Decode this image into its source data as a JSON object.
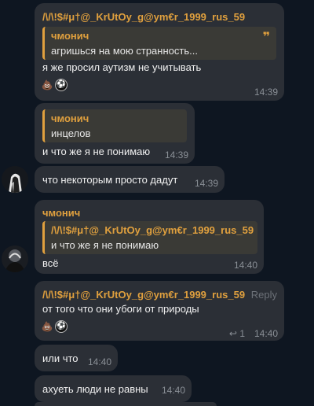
{
  "messages": [
    {
      "sender": "/\\/\\!$#μ†@_KrUtOy_g@ym€r_1999_rus_59",
      "reply": {
        "name": "чмонич",
        "text": "агришься на мою странность..."
      },
      "text": "я же просил аутизм не учитывать",
      "reactions": {
        "poo": "💩",
        "ball": "⚽"
      },
      "time": "14:39"
    },
    {
      "reply": {
        "name": "чмонич",
        "text": "инцелов"
      },
      "text": "и что же я не понимаю",
      "time": "14:39"
    },
    {
      "text": "что некоторым просто дадут",
      "time": "14:39"
    },
    {
      "sender": "чмонич",
      "reply": {
        "name": "/\\/\\!$#μ†@_KrUtOy_g@ym€r_1999_rus_59",
        "text": "и что же я не понимаю"
      },
      "text": "всё",
      "time": "14:40"
    },
    {
      "sender": "/\\/\\!$#μ†@_KrUtOy_g@ym€r_1999_rus_59",
      "reply_button": "Reply",
      "text": "от того что они убоги от природы",
      "reactions": {
        "poo": "💩",
        "ball": "⚽"
      },
      "forward_count": "1",
      "time": "14:40"
    },
    {
      "text": "или что",
      "time": "14:40"
    },
    {
      "text": "ахуеть люди не равны",
      "time": "14:40"
    }
  ],
  "icons": {
    "quote": "quote-icon",
    "forward": "forward-icon",
    "avatar": "user-avatar"
  }
}
